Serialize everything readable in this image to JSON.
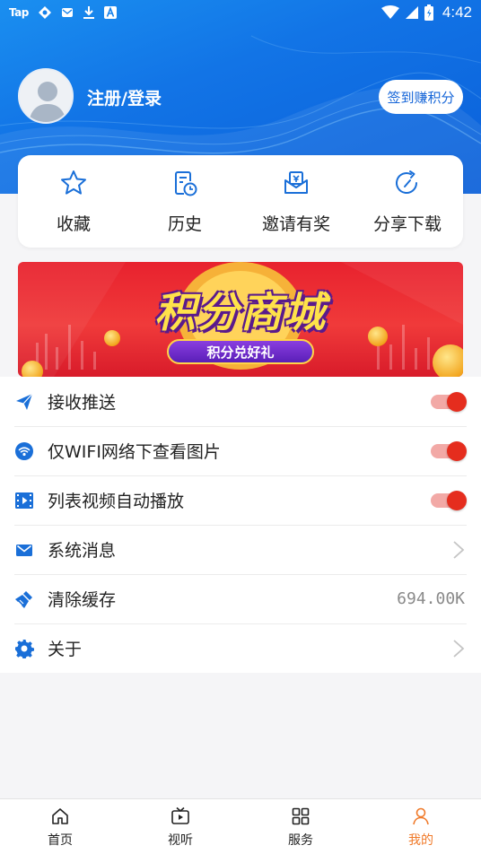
{
  "status_bar": {
    "left_items": [
      "Tap",
      "sync-icon",
      "mail-icon",
      "download-icon",
      "a-icon"
    ],
    "time": "4:42"
  },
  "header": {
    "login_label": "注册/登录",
    "signin_button": "签到赚积分"
  },
  "quick_actions": [
    {
      "label": "收藏",
      "icon": "star-icon"
    },
    {
      "label": "历史",
      "icon": "history-icon"
    },
    {
      "label": "邀请有奖",
      "icon": "invite-icon"
    },
    {
      "label": "分享下载",
      "icon": "share-icon"
    }
  ],
  "banner": {
    "title": "积分商城",
    "subtitle": "积分兑好礼"
  },
  "settings": [
    {
      "label": "接收推送",
      "icon": "send-icon",
      "type": "toggle",
      "on": true
    },
    {
      "label": "仅WIFI网络下查看图片",
      "icon": "wifi-icon",
      "type": "toggle",
      "on": true
    },
    {
      "label": "列表视频自动播放",
      "icon": "video-icon",
      "type": "toggle",
      "on": true
    },
    {
      "label": "系统消息",
      "icon": "mail-icon",
      "type": "arrow"
    },
    {
      "label": "清除缓存",
      "icon": "broom-icon",
      "type": "value",
      "value": "694.00K"
    },
    {
      "label": "关于",
      "icon": "gear-icon",
      "type": "arrow"
    }
  ],
  "tabbar": [
    {
      "label": "首页",
      "icon": "home-icon",
      "active": false
    },
    {
      "label": "视听",
      "icon": "tv-icon",
      "active": false
    },
    {
      "label": "服务",
      "icon": "grid-icon",
      "active": false
    },
    {
      "label": "我的",
      "icon": "user-icon",
      "active": true
    }
  ],
  "colors": {
    "brand_blue": "#1274e6",
    "toggle_on": "#e52d1e",
    "icon_blue": "#1a6fd8",
    "tab_active": "#f07a2a"
  }
}
